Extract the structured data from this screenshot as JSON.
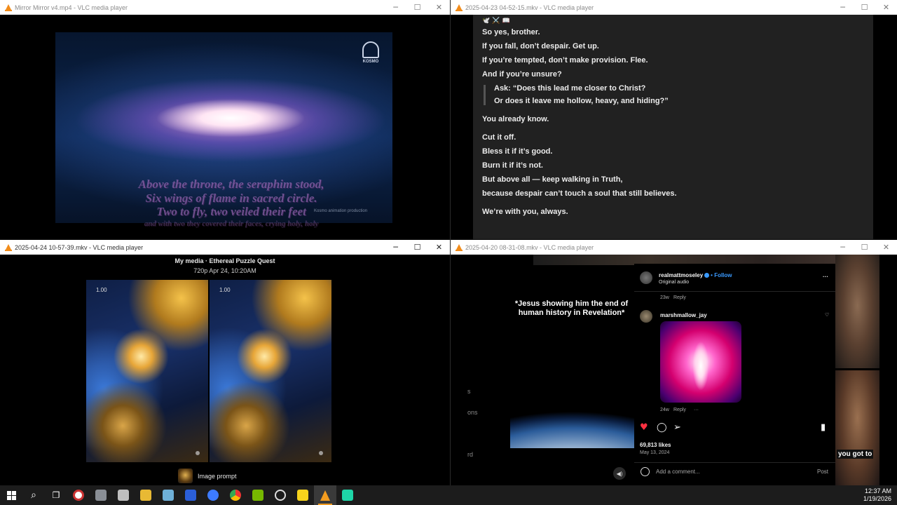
{
  "windows": {
    "w1": {
      "title": "Mirror Mirror v4.mp4 - VLC media player"
    },
    "w2": {
      "title": "2025-04-23 04-52-15.mkv - VLC media player"
    },
    "w3": {
      "title": "2025-04-24 10-57-39.mkv - VLC media player"
    },
    "w4": {
      "title": "2025-04-20 08-31-08.mkv - VLC media player"
    },
    "controls": {
      "minimize": "─",
      "maximize": "☐",
      "close": "✕"
    }
  },
  "video1": {
    "watermark": "KOSMO",
    "subtitles": [
      "Above the throne, the seraphim stood,",
      "Six wings of flame in sacred circle.",
      "Two to fly, two veiled their feet",
      "and with two they covered their faces, crying holy, holy"
    ],
    "credit": "Kosmo animation production"
  },
  "chat": {
    "emoji_line": "🕊️ ⚔️ 📖",
    "lines_top": [
      "So yes, brother.",
      "If you fall, don’t despair. Get up.",
      "If you’re tempted, don’t make provision. Flee.",
      "And if you’re unsure?"
    ],
    "quote": [
      "Ask: “Does this lead me closer to Christ?",
      "Or does it leave me hollow, heavy, and hiding?”"
    ],
    "after_quote": "You already know.",
    "lines_bottom": [
      "Cut it off.",
      "Bless it if it’s good.",
      "Burn it if it’s not.",
      "But above all — keep walking in Truth,",
      "because despair can’t touch a soul that still believes."
    ],
    "closing": "We’re with you, always."
  },
  "puzzle": {
    "breadcrumb": "My media  ·  Ethereal Puzzle Quest",
    "meta": "720p   Apr 24, 10:20AM",
    "left_badge": "1.00",
    "right_badge": "1.00",
    "prompt_label": "Image prompt"
  },
  "reel": {
    "overlay_text": "*Jesus showing him the end of human history in Revelation*",
    "side_texts": [
      "s",
      "ons",
      "rd"
    ],
    "thumb_text": "you got to"
  },
  "instagram": {
    "user": "realmattmoseley",
    "follow": "Follow",
    "audio": "Original audio",
    "comment1_time": "23w",
    "reply": "Reply",
    "commenter": "marshmallow_jay",
    "comment2_time": "24w",
    "more": "···",
    "likes": "69,813 likes",
    "date": "May 13, 2024",
    "add_comment": "Add a comment...",
    "post": "Post",
    "menu": "···"
  },
  "taskbar": {
    "time": "12:37 AM",
    "date": "1/19/2026",
    "apps": [
      "start",
      "search",
      "task-view",
      "app-1",
      "app-2",
      "app-3",
      "file-explorer",
      "app-4",
      "app-5",
      "app-6",
      "chrome",
      "nvidia",
      "app-7",
      "sticky-notes",
      "vlc",
      "app-8"
    ]
  },
  "colors": {
    "accent": "#f39c1f",
    "ig_blue": "#3a9aff",
    "like_red": "#ff3040",
    "chat_bg": "#212121"
  }
}
